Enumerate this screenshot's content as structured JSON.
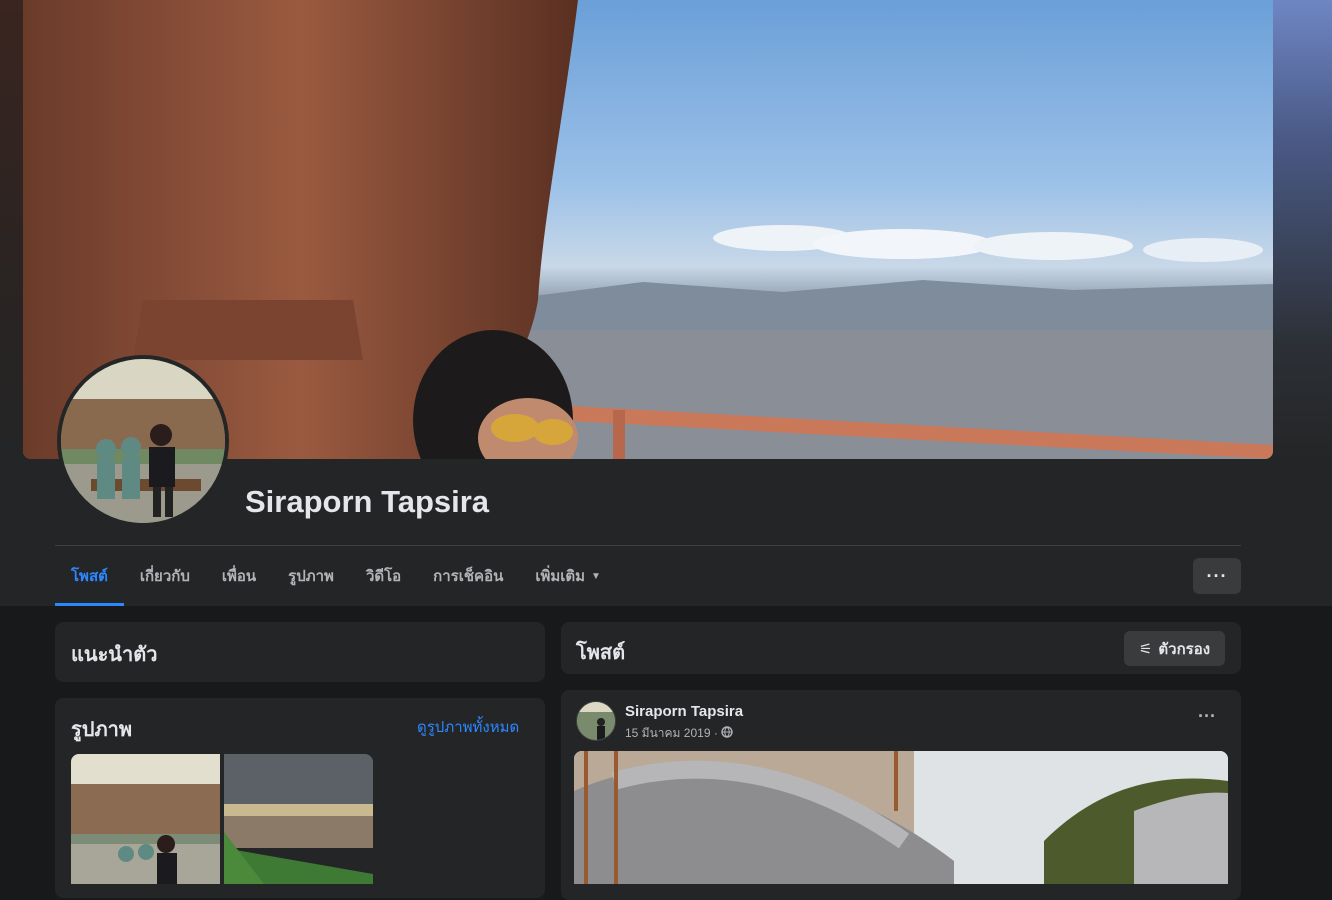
{
  "profile": {
    "name": "Siraporn Tapsira"
  },
  "tabs": [
    {
      "label": "โพสต์",
      "active": true
    },
    {
      "label": "เกี่ยวกับ"
    },
    {
      "label": "เพื่อน"
    },
    {
      "label": "รูปภาพ"
    },
    {
      "label": "วิดีโอ"
    },
    {
      "label": "การเช็คอิน"
    },
    {
      "label": "เพิ่มเติม"
    }
  ],
  "more_button": {
    "label": "···"
  },
  "intro": {
    "title": "แนะนำตัว"
  },
  "photos": {
    "title": "รูปภาพ",
    "see_all": "ดูรูปภาพทั้งหมด"
  },
  "posts": {
    "title": "โพสต์",
    "filter_label": "ตัวกรอง"
  },
  "post": {
    "author": "Siraporn Tapsira",
    "date": "15 มีนาคม 2019 ·",
    "menu": "···",
    "privacy_icon": "globe-icon"
  },
  "colors": {
    "accent": "#2d88ff",
    "card_bg": "#242526",
    "page_bg": "#18191a",
    "button_bg": "#3a3b3c"
  }
}
